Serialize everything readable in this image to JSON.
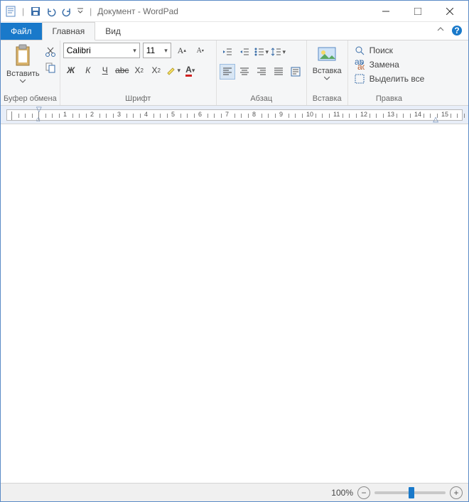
{
  "title": "Документ - WordPad",
  "tabs": {
    "file": "Файл",
    "home": "Главная",
    "view": "Вид"
  },
  "groups": {
    "clipboard": {
      "label": "Буфер обмена",
      "paste": "Вставить"
    },
    "font": {
      "label": "Шрифт",
      "name": "Calibri",
      "size": "11"
    },
    "paragraph": {
      "label": "Абзац"
    },
    "insert": {
      "label": "Вставка",
      "btn": "Вставка"
    },
    "editing": {
      "label": "Правка",
      "find": "Поиск",
      "replace": "Замена",
      "selectall": "Выделить все"
    }
  },
  "status": {
    "zoom": "100%"
  }
}
